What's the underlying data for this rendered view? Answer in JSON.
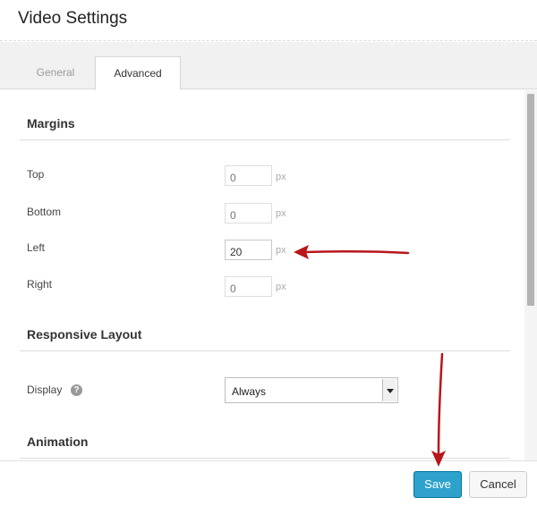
{
  "dialog": {
    "title": "Video Settings"
  },
  "tabs": [
    {
      "label": "General",
      "active": false
    },
    {
      "label": "Advanced",
      "active": true
    }
  ],
  "margins": {
    "heading": "Margins",
    "unit": "px",
    "fields": [
      {
        "label": "Top",
        "value": "",
        "placeholder": "0"
      },
      {
        "label": "Bottom",
        "value": "",
        "placeholder": "0"
      },
      {
        "label": "Left",
        "value": "20",
        "placeholder": "0"
      },
      {
        "label": "Right",
        "value": "",
        "placeholder": "0"
      }
    ]
  },
  "responsive": {
    "heading": "Responsive Layout",
    "display_label": "Display",
    "help_icon": "help-icon",
    "display_value": "Always"
  },
  "animation": {
    "heading": "Animation"
  },
  "footer": {
    "save_label": "Save",
    "cancel_label": "Cancel"
  },
  "colors": {
    "save_button": "#2ea2cc",
    "annotation_arrow": "#b8161b"
  }
}
